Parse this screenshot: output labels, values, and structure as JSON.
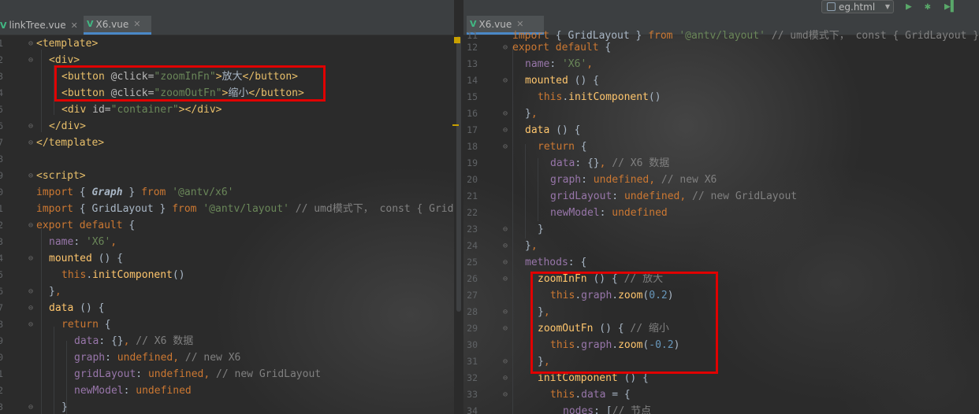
{
  "toolbar": {
    "run_config_label": "eg.html",
    "run_icon": "play-icon",
    "debug_icon": "bug-icon",
    "stop_icon": "stop-icon"
  },
  "left_pane": {
    "tabs": [
      {
        "label": "linkTree.vue",
        "active": false
      },
      {
        "label": "X6.vue",
        "active": true
      }
    ]
  },
  "right_pane": {
    "tabs": [
      {
        "label": "X6.vue",
        "active": true
      }
    ]
  },
  "colors": {
    "highlight_box": "#e00000",
    "keyword": "#cc7832",
    "string": "#6a8759",
    "property": "#9876aa",
    "tag": "#e8bf6a",
    "comment": "#808080"
  }
}
